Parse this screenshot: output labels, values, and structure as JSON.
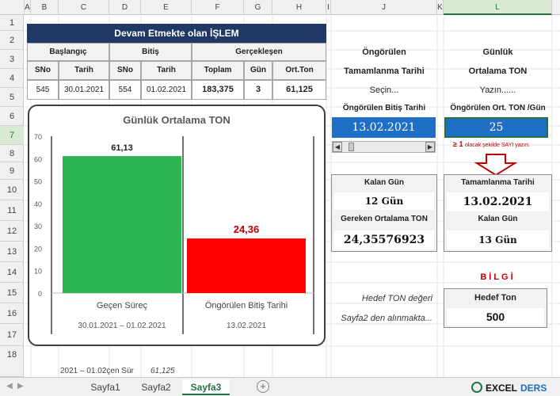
{
  "columns": [
    "A",
    "B",
    "C",
    "D",
    "E",
    "F",
    "G",
    "H",
    "I",
    "J",
    "K",
    "L"
  ],
  "rows": [
    "1",
    "2",
    "3",
    "4",
    "5",
    "6",
    "7",
    "8",
    "9",
    "10",
    "11",
    "12",
    "13",
    "14",
    "15",
    "16",
    "17",
    "18"
  ],
  "table": {
    "title": "Devam Etmekte olan İŞLEM",
    "group_start": "Başlangıç",
    "group_end": "Bitiş",
    "group_realized": "Gerçekleşen",
    "col_sno1": "SNo",
    "col_tarih1": "Tarih",
    "col_sno2": "SNo",
    "col_tarih2": "Tarih",
    "col_toplam": "Toplam",
    "col_gun": "Gün",
    "col_orton": "Ort.Ton",
    "row": {
      "sno1": "545",
      "tarih1": "30.01.2021",
      "sno2": "554",
      "tarih2": "01.02.2021",
      "toplam": "183,375",
      "gun": "3",
      "orton": "61,125"
    }
  },
  "chart_data": {
    "type": "bar",
    "title": "Günlük Ortalama TON",
    "categories": [
      "Geçen Süreç",
      "Öngörülen Bitiş Tarihi"
    ],
    "subcategories": [
      "30.01.2021 – 01.02.2021",
      "13.02.2021"
    ],
    "values": [
      61.13,
      24.36
    ],
    "value_labels": [
      "61,13",
      "24,36"
    ],
    "colors": [
      "#2db552",
      "#ff0000"
    ],
    "label_colors": [
      "#222222",
      "#c00000"
    ],
    "ylim": [
      0,
      70
    ],
    "yticks": [
      "0",
      "10",
      "20",
      "30",
      "40",
      "50",
      "60",
      "70"
    ]
  },
  "right": {
    "ongorulen": "Öngörülen",
    "tamamlanma_tarihi": "Tamamlanma Tarihi",
    "secin": "Seçin...",
    "ongorulen_bitis_tarihi": "Öngörülen Bitiş Tarihi",
    "date_value": "13.02.2021",
    "gunluk": "Günlük",
    "ortalama_ton": "Ortalama TON",
    "yazin": "Yazın......",
    "ongorulen_ort_ton": "Öngörülen Ort. TON /Gün",
    "ton_value": "25",
    "hint_symbol": "≥ 1",
    "hint_text": "olacak şekilde SAYI yazın.",
    "kalan_gun_label": "Kalan Gün",
    "kalan_gun_value": "12  Gün",
    "gereken_label": "Gereken Ortalama TON",
    "gereken_value": "24,35576923",
    "tamamlanma_label": "Tamamlanma Tarihi",
    "tamamlanma_value": "13.02.2021",
    "kalan_gun2_label": "Kalan Gün",
    "kalan_gun2_value": "13  Gün",
    "bilgi": "BİLGİ",
    "hedef_ton_degeri": "Hedef TON değeri",
    "sayfa2_note": "Sayfa2 den alınmakta...",
    "hedef_ton_label": "Hedef Ton",
    "hedef_ton_value": "500",
    "bottom_text": "2021 – 01.02çen Sür",
    "bottom_value": "61,125"
  },
  "tabs": [
    "Sayfa1",
    "Sayfa2",
    "Sayfa3"
  ],
  "active_tab": "Sayfa3",
  "add_sheet": "+",
  "colors": {
    "accent": "#217346",
    "header_navy": "#1f3864",
    "date_blue": "#1f6fc6",
    "hint_red": "#c00000",
    "arrow_red": "#c00000"
  }
}
